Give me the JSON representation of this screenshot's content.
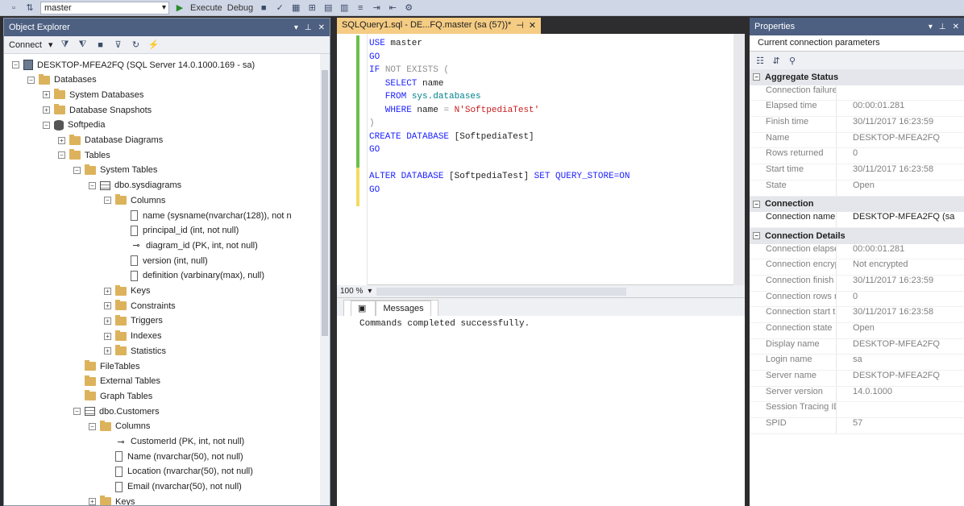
{
  "toolbar": {
    "database": "master",
    "execute_label": "Execute",
    "debug_label": "Debug"
  },
  "object_explorer": {
    "title": "Object Explorer",
    "connect_label": "Connect",
    "tree": [
      {
        "label": "DESKTOP-MFEA2FQ (SQL Server 14.0.1000.169 - sa)",
        "icon": "server-icon",
        "level": 0,
        "expander": "−"
      },
      {
        "label": "Databases",
        "icon": "folder-icon",
        "level": 1,
        "expander": "−"
      },
      {
        "label": "System Databases",
        "icon": "folder-icon",
        "level": 2,
        "expander": "+"
      },
      {
        "label": "Database Snapshots",
        "icon": "folder-icon",
        "level": 2,
        "expander": "+"
      },
      {
        "label": "Softpedia",
        "icon": "database-icon",
        "level": 2,
        "expander": "−"
      },
      {
        "label": "Database Diagrams",
        "icon": "folder-icon",
        "level": 3,
        "expander": "+"
      },
      {
        "label": "Tables",
        "icon": "folder-icon",
        "level": 3,
        "expander": "−"
      },
      {
        "label": "System Tables",
        "icon": "folder-icon",
        "level": 4,
        "expander": "−"
      },
      {
        "label": "dbo.sysdiagrams",
        "icon": "table-icon",
        "level": 5,
        "expander": "−"
      },
      {
        "label": "Columns",
        "icon": "folder-icon",
        "level": 6,
        "expander": "−"
      },
      {
        "label": "name (sysname(nvarchar(128)), not n",
        "icon": "column-icon",
        "level": 7,
        "expander": ""
      },
      {
        "label": "principal_id (int, not null)",
        "icon": "column-icon",
        "level": 7,
        "expander": ""
      },
      {
        "label": "diagram_id (PK, int, not null)",
        "icon": "key-icon",
        "level": 7,
        "expander": ""
      },
      {
        "label": "version (int, null)",
        "icon": "column-icon",
        "level": 7,
        "expander": ""
      },
      {
        "label": "definition (varbinary(max), null)",
        "icon": "column-icon",
        "level": 7,
        "expander": ""
      },
      {
        "label": "Keys",
        "icon": "folder-icon",
        "level": 6,
        "expander": "+"
      },
      {
        "label": "Constraints",
        "icon": "folder-icon",
        "level": 6,
        "expander": "+"
      },
      {
        "label": "Triggers",
        "icon": "folder-icon",
        "level": 6,
        "expander": "+"
      },
      {
        "label": "Indexes",
        "icon": "folder-icon",
        "level": 6,
        "expander": "+"
      },
      {
        "label": "Statistics",
        "icon": "folder-icon",
        "level": 6,
        "expander": "+"
      },
      {
        "label": "FileTables",
        "icon": "folder-icon",
        "level": 4,
        "expander": ""
      },
      {
        "label": "External Tables",
        "icon": "folder-icon",
        "level": 4,
        "expander": ""
      },
      {
        "label": "Graph Tables",
        "icon": "folder-icon",
        "level": 4,
        "expander": ""
      },
      {
        "label": "dbo.Customers",
        "icon": "table-icon",
        "level": 4,
        "expander": "−"
      },
      {
        "label": "Columns",
        "icon": "folder-icon",
        "level": 5,
        "expander": "−"
      },
      {
        "label": "CustomerId (PK, int, not null)",
        "icon": "key-icon",
        "level": 6,
        "expander": ""
      },
      {
        "label": "Name (nvarchar(50), not null)",
        "icon": "column-icon",
        "level": 6,
        "expander": ""
      },
      {
        "label": "Location (nvarchar(50), not null)",
        "icon": "column-icon",
        "level": 6,
        "expander": ""
      },
      {
        "label": "Email (nvarchar(50), not null)",
        "icon": "column-icon",
        "level": 6,
        "expander": ""
      },
      {
        "label": "Keys",
        "icon": "folder-icon",
        "level": 5,
        "expander": "+"
      }
    ]
  },
  "editor": {
    "tab_title": "SQLQuery1.sql - DE...FQ.master (sa (57))*",
    "zoom": "100 %",
    "code_lines": [
      [
        {
          "t": "USE ",
          "c": "kw"
        },
        {
          "t": "master",
          "c": ""
        }
      ],
      [
        {
          "t": "GO",
          "c": "kw"
        }
      ],
      [
        {
          "t": "IF ",
          "c": "kw"
        },
        {
          "t": "NOT EXISTS (",
          "c": "gr"
        }
      ],
      [
        {
          "t": "   SELECT ",
          "c": "kw"
        },
        {
          "t": "name",
          "c": ""
        }
      ],
      [
        {
          "t": "   FROM ",
          "c": "kw"
        },
        {
          "t": "sys.databases",
          "c": "obj"
        }
      ],
      [
        {
          "t": "   WHERE ",
          "c": "kw"
        },
        {
          "t": "name ",
          "c": ""
        },
        {
          "t": "= ",
          "c": "gr"
        },
        {
          "t": "N'SoftpediaTest'",
          "c": "str"
        }
      ],
      [
        {
          "t": ")",
          "c": "gr"
        }
      ],
      [
        {
          "t": "CREATE DATABASE ",
          "c": "kw"
        },
        {
          "t": "[SoftpediaTest]",
          "c": ""
        }
      ],
      [
        {
          "t": "GO",
          "c": "kw"
        }
      ],
      [],
      [
        {
          "t": "ALTER DATABASE ",
          "c": "kw"
        },
        {
          "t": "[SoftpediaTest] ",
          "c": ""
        },
        {
          "t": "SET QUERY_STORE=ON",
          "c": "kw"
        }
      ],
      [
        {
          "t": "GO",
          "c": "kw"
        }
      ]
    ],
    "messages_tab": "Messages",
    "message": "Commands completed successfully."
  },
  "properties": {
    "title": "Properties",
    "combo": "Current connection parameters",
    "groups": [
      {
        "name": "Aggregate Status",
        "rows": [
          {
            "k": "Connection failure",
            "v": ""
          },
          {
            "k": "Elapsed time",
            "v": "00:00:01.281"
          },
          {
            "k": "Finish time",
            "v": "30/11/2017 16:23:59"
          },
          {
            "k": "Name",
            "v": "DESKTOP-MFEA2FQ"
          },
          {
            "k": "Rows returned",
            "v": "0"
          },
          {
            "k": "Start time",
            "v": "30/11/2017 16:23:58"
          },
          {
            "k": "State",
            "v": "Open"
          }
        ]
      },
      {
        "name": "Connection",
        "rows": [
          {
            "k": "Connection name",
            "v": "DESKTOP-MFEA2FQ (sa",
            "bold": true
          }
        ]
      },
      {
        "name": "Connection Details",
        "rows": [
          {
            "k": "Connection elapse",
            "v": "00:00:01.281"
          },
          {
            "k": "Connection encryp",
            "v": "Not encrypted"
          },
          {
            "k": "Connection finish t",
            "v": "30/11/2017 16:23:59"
          },
          {
            "k": "Connection rows re",
            "v": "0"
          },
          {
            "k": "Connection start ti",
            "v": "30/11/2017 16:23:58"
          },
          {
            "k": "Connection state",
            "v": "Open"
          },
          {
            "k": "Display name",
            "v": "DESKTOP-MFEA2FQ"
          },
          {
            "k": "Login name",
            "v": "sa"
          },
          {
            "k": "Server name",
            "v": "DESKTOP-MFEA2FQ"
          },
          {
            "k": "Server version",
            "v": "14.0.1000"
          },
          {
            "k": "Session Tracing ID",
            "v": ""
          },
          {
            "k": "SPID",
            "v": "57"
          }
        ]
      }
    ]
  }
}
